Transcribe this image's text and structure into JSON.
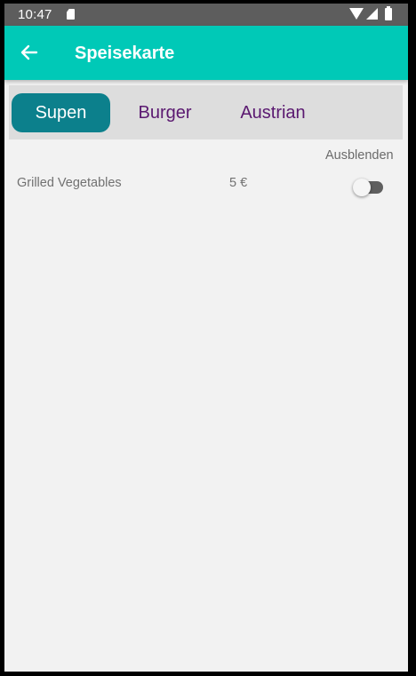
{
  "status_bar": {
    "time": "10:47",
    "icons": [
      "sd-card-icon",
      "wifi-icon",
      "signal-icon",
      "battery-icon"
    ]
  },
  "app_bar": {
    "title": "Speisekarte",
    "back_icon": "arrow-left-icon",
    "color": "#00c9b7"
  },
  "tabs": {
    "items": [
      {
        "label": "Supen",
        "selected": true
      },
      {
        "label": "Burger",
        "selected": false
      },
      {
        "label": "Austrian",
        "selected": false
      }
    ],
    "active_color": "#0c808c",
    "inactive_text_color": "#5a1870"
  },
  "menu": {
    "hide_column_label": "Ausblenden",
    "items": [
      {
        "name": "Grilled Vegetables",
        "price": "5 €",
        "hidden": false
      }
    ]
  }
}
